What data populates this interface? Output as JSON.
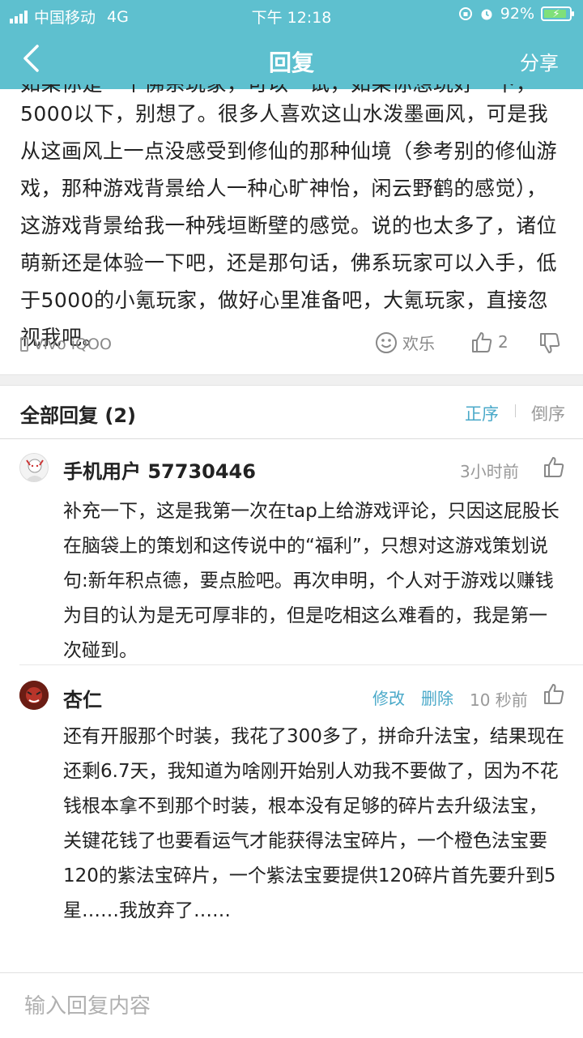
{
  "status_bar": {
    "carrier": "中国移动",
    "network": "4G",
    "time": "下午 12:18",
    "battery": "92%"
  },
  "nav": {
    "title": "回复",
    "share": "分享"
  },
  "post": {
    "partial_line": "如果你是一个佛系玩家，可以一试，如果你想玩好一下，",
    "body": "5000以下，别想了。很多人喜欢这山水泼墨画风，可是我从这画风上一点没感受到修仙的那种仙境（参考别的修仙游戏，那种游戏背景给人一种心旷神怡，闲云野鹤的感觉），这游戏背景给我一种残垣断壁的感觉。说的也太多了，诸位萌新还是体验一下吧，还是那句话，佛系玩家可以入手，低于5000的小氪玩家，做好心里准备吧，大氪玩家，直接忽视我吧。",
    "device": "Vivo iQOO",
    "emoji_label": "欢乐",
    "like_count": "2"
  },
  "replies": {
    "title": "全部回复 (2)",
    "sort_asc": "正序",
    "sort_desc": "倒序",
    "items": [
      {
        "name": "手机用户 57730446",
        "time": "3小时前",
        "text": "补充一下，这是我第一次在tap上给游戏评论，只因这屁股长在脑袋上的策划和这传说中的“福利”，只想对这游戏策划说句:新年积点德，要点脸吧。再次申明，个人对于游戏以赚钱为目的认为是无可厚非的，但是吃相这么难看的，我是第一次碰到。"
      },
      {
        "name": "杏仁",
        "edit": "修改",
        "delete": "删除",
        "time": "10 秒前",
        "text": "还有开服那个时装，我花了300多了，拼命升法宝，结果现在还剩6.7天，我知道为啥刚开始别人劝我不要做了，因为不花钱根本拿不到那个时装，根本没有足够的碎片去升级法宝，关键花钱了也要看运气才能获得法宝碎片，一个橙色法宝要120的紫法宝碎片，一个紫法宝要提供120碎片首先要升到5星……我放弃了……"
      }
    ]
  },
  "input": {
    "placeholder": "输入回复内容"
  },
  "colors": {
    "header": "#5ec0cf",
    "link": "#4aa9c9"
  }
}
